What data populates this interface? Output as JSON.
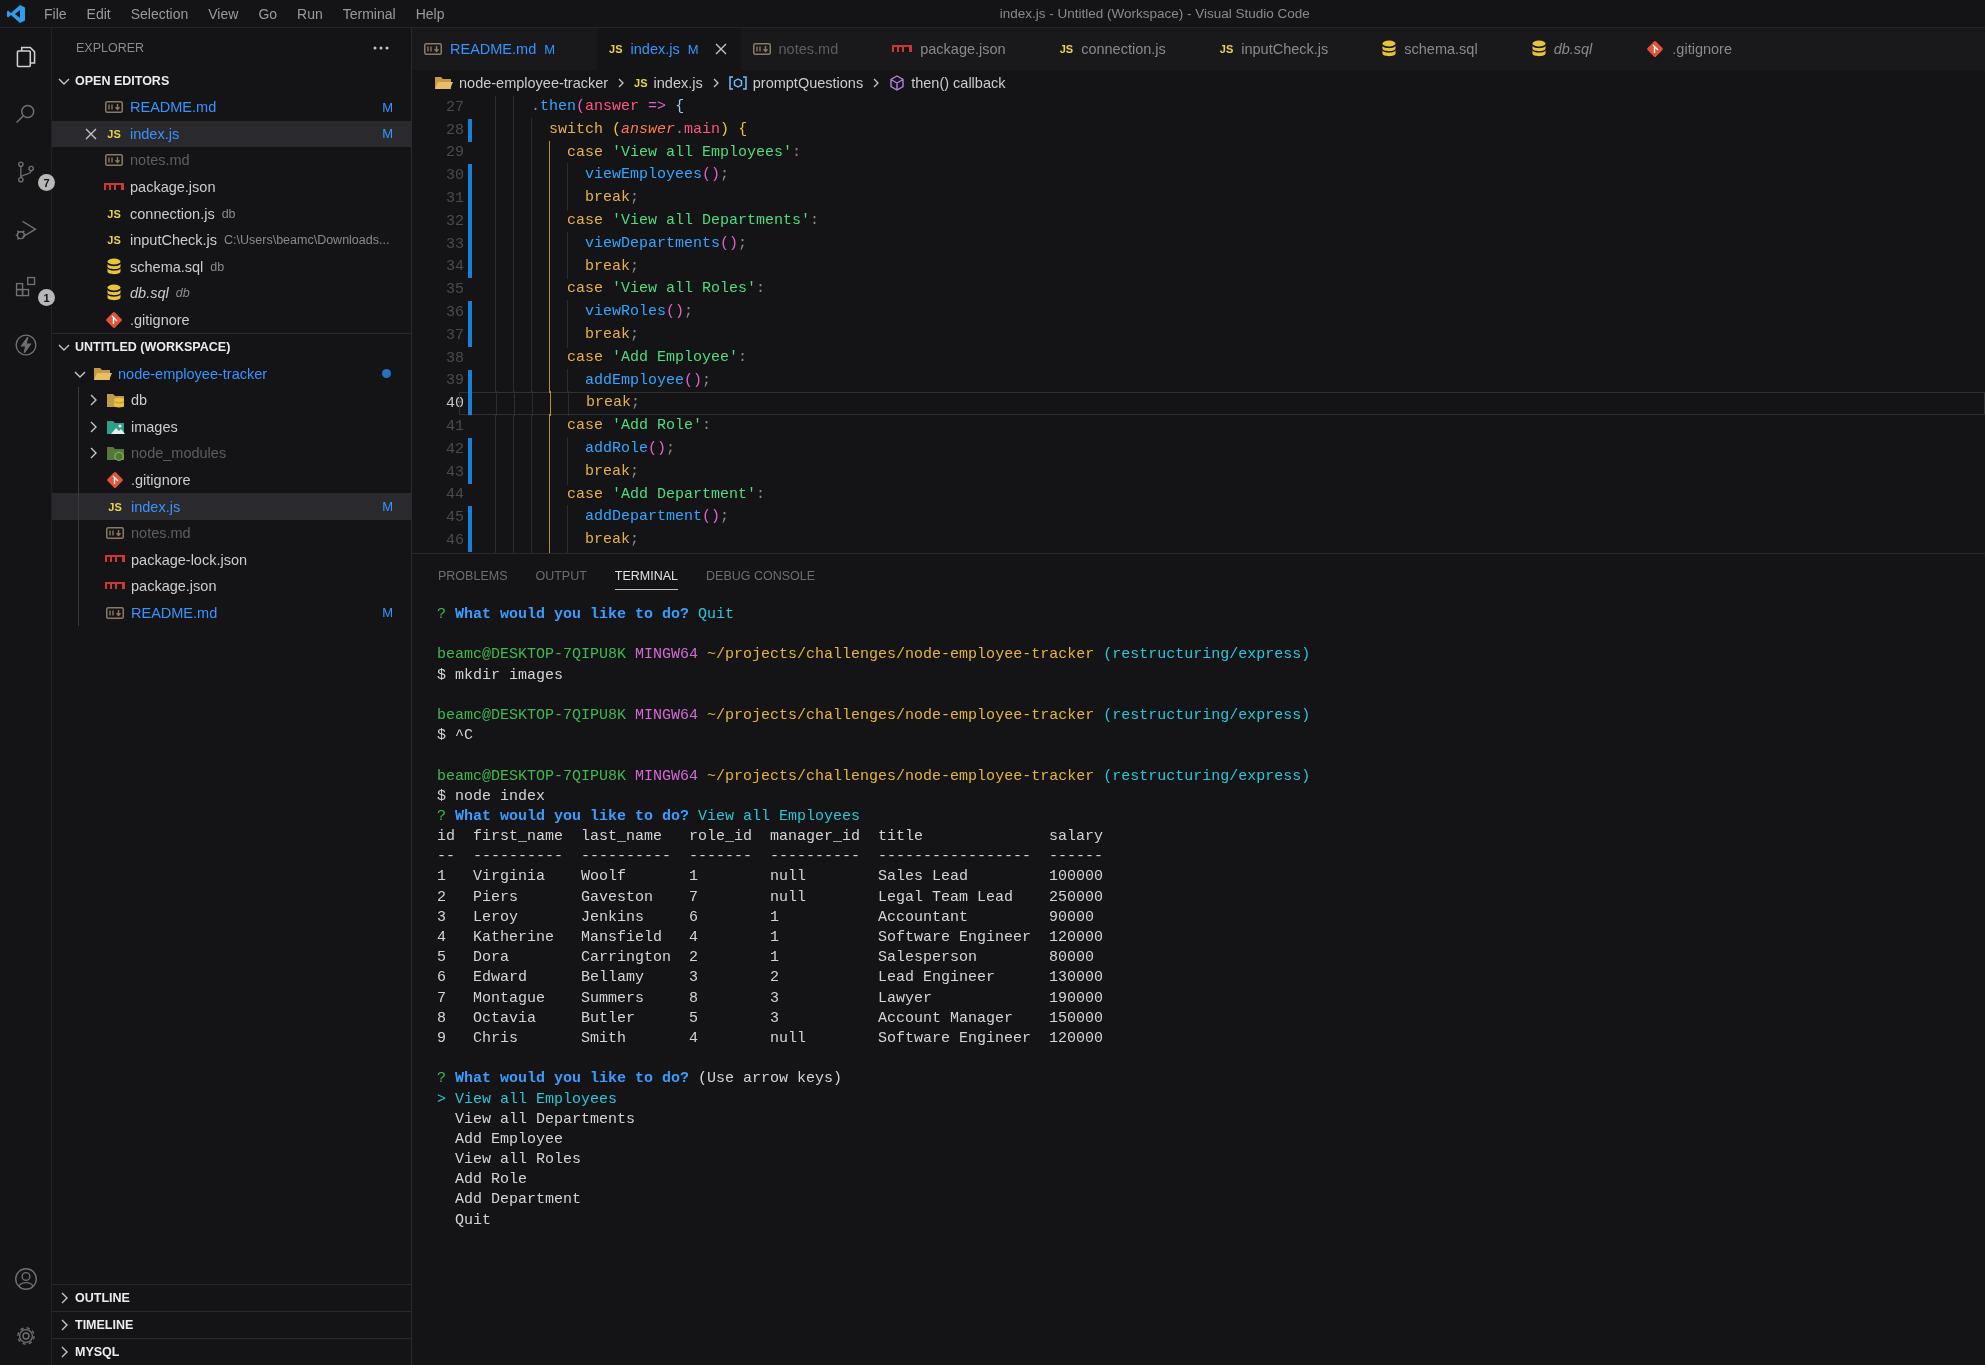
{
  "window": {
    "title": "index.js - Untitled (Workspace) - Visual Studio Code"
  },
  "menu": [
    "File",
    "Edit",
    "Selection",
    "View",
    "Go",
    "Run",
    "Terminal",
    "Help"
  ],
  "activity_bar": [
    {
      "kind": "explorer",
      "selected": true
    },
    {
      "kind": "search",
      "selected": false
    },
    {
      "kind": "source-control",
      "selected": false,
      "badge": "7"
    },
    {
      "kind": "run-debug",
      "selected": false
    },
    {
      "kind": "extensions",
      "selected": false,
      "badge": "1"
    },
    {
      "kind": "lightning",
      "selected": false
    },
    {
      "kind": "account",
      "selected": false
    },
    {
      "kind": "settings",
      "selected": false
    }
  ],
  "sidebar": {
    "title": "EXPLORER",
    "open_editors": {
      "title": "OPEN EDITORS",
      "expanded": true,
      "items": [
        {
          "kind": "markdown",
          "name": "README.md",
          "modified": true,
          "ignored": false,
          "italic": false,
          "badge": "M",
          "selected": false
        },
        {
          "kind": "js",
          "glyph": "JS",
          "name": "index.js",
          "modified": true,
          "ignored": false,
          "italic": false,
          "badge": "M",
          "selected": true
        },
        {
          "kind": "markdown",
          "name": "notes.md",
          "modified": false,
          "ignored": true,
          "italic": false,
          "selected": false
        },
        {
          "kind": "npm",
          "name": "package.json",
          "modified": false,
          "ignored": false,
          "italic": false,
          "selected": false
        },
        {
          "kind": "js",
          "glyph": "JS",
          "name": "connection.js",
          "description": "db",
          "modified": false,
          "ignored": false,
          "italic": false,
          "selected": false
        },
        {
          "kind": "js",
          "glyph": "JS",
          "name": "inputCheck.js",
          "description": "C:\\Users\\beamc\\Downloads...",
          "modified": false,
          "ignored": false,
          "italic": false,
          "selected": false
        },
        {
          "kind": "database",
          "name": "schema.sql",
          "description": "db",
          "modified": false,
          "ignored": false,
          "italic": false,
          "selected": false
        },
        {
          "kind": "database",
          "name": "db.sql",
          "description": "db",
          "modified": false,
          "ignored": false,
          "italic": true,
          "selected": false
        },
        {
          "kind": "git",
          "name": ".gitignore",
          "modified": false,
          "ignored": false,
          "italic": false,
          "selected": false
        }
      ]
    },
    "workspace": {
      "title": "UNTITLED (WORKSPACE)",
      "expanded": true,
      "tree": [
        {
          "name": "node-employee-tracker",
          "kind": "folder",
          "modified": true,
          "ignored": false,
          "dot": true,
          "expanded": true,
          "selected": false,
          "children": [
            {
              "name": "db",
              "kind": "folder-db",
              "modified": false,
              "ignored": false,
              "expanded": false,
              "selected": false
            },
            {
              "name": "images",
              "kind": "folder-images",
              "modified": false,
              "ignored": false,
              "expanded": false,
              "selected": false
            },
            {
              "name": "node_modules",
              "kind": "folder-node",
              "modified": false,
              "ignored": true,
              "expanded": false,
              "selected": false
            },
            {
              "name": ".gitignore",
              "kind": "git",
              "modified": false,
              "ignored": false,
              "selected": false
            },
            {
              "name": "index.js",
              "kind": "js",
              "glyph": "JS",
              "modified": true,
              "ignored": false,
              "badge": "M",
              "selected": true
            },
            {
              "name": "notes.md",
              "kind": "markdown",
              "modified": false,
              "ignored": true,
              "selected": false
            },
            {
              "name": "package-lock.json",
              "kind": "npm",
              "modified": false,
              "ignored": false,
              "selected": false
            },
            {
              "name": "package.json",
              "kind": "npm",
              "modified": false,
              "ignored": false,
              "selected": false
            },
            {
              "name": "README.md",
              "kind": "markdown",
              "modified": true,
              "ignored": false,
              "badge": "M",
              "selected": false
            }
          ]
        }
      ]
    },
    "sections": [
      {
        "title": "OUTLINE",
        "expanded": false
      },
      {
        "title": "TIMELINE",
        "expanded": false
      },
      {
        "title": "MYSQL",
        "expanded": false
      }
    ]
  },
  "tabs": [
    {
      "kind": "markdown",
      "label": "README.md",
      "badge": "M",
      "modified": true,
      "ignored": false,
      "italic": false,
      "selected": false
    },
    {
      "kind": "js",
      "glyph": "JS",
      "label": "index.js",
      "badge": "M",
      "modified": true,
      "ignored": false,
      "italic": false,
      "selected": true
    },
    {
      "kind": "markdown",
      "label": "notes.md",
      "modified": false,
      "ignored": true,
      "italic": false,
      "selected": false
    },
    {
      "kind": "npm",
      "label": "package.json",
      "modified": false,
      "ignored": false,
      "italic": false,
      "selected": false
    },
    {
      "kind": "js",
      "glyph": "JS",
      "label": "connection.js",
      "modified": false,
      "ignored": false,
      "italic": false,
      "selected": false
    },
    {
      "kind": "js",
      "glyph": "JS",
      "label": "inputCheck.js",
      "modified": false,
      "ignored": false,
      "italic": false,
      "selected": false
    },
    {
      "kind": "database",
      "label": "schema.sql",
      "modified": false,
      "ignored": false,
      "italic": false,
      "selected": false
    },
    {
      "kind": "database",
      "label": "db.sql",
      "modified": false,
      "ignored": false,
      "italic": true,
      "selected": false
    },
    {
      "kind": "git",
      "label": ".gitignore",
      "modified": false,
      "ignored": false,
      "italic": false,
      "selected": false
    }
  ],
  "breadcrumb": [
    {
      "kind": "folder",
      "text": "node-employee-tracker"
    },
    {
      "kind": "js",
      "glyph": "JS",
      "text": "index.js"
    },
    {
      "kind": "variable",
      "text": "promptQuestions"
    },
    {
      "kind": "method",
      "text": "then() callback"
    }
  ],
  "editor": {
    "lines": [
      {
        "number": "27",
        "changed": false,
        "current": false,
        "bracket_guide": false,
        "text": "    .then(answer => {"
      },
      {
        "number": "28",
        "changed": true,
        "current": false,
        "bracket_guide": false,
        "text": "      switch (answer.main) {"
      },
      {
        "number": "29",
        "changed": false,
        "current": false,
        "bracket_guide": true,
        "text": "        case 'View all Employees':"
      },
      {
        "number": "30",
        "changed": true,
        "current": false,
        "bracket_guide": true,
        "text": "          viewEmployees();"
      },
      {
        "number": "31",
        "changed": true,
        "current": false,
        "bracket_guide": true,
        "text": "          break;"
      },
      {
        "number": "32",
        "changed": true,
        "current": false,
        "bracket_guide": true,
        "text": "        case 'View all Departments':"
      },
      {
        "number": "33",
        "changed": true,
        "current": false,
        "bracket_guide": true,
        "text": "          viewDepartments();"
      },
      {
        "number": "34",
        "changed": true,
        "current": false,
        "bracket_guide": true,
        "text": "          break;"
      },
      {
        "number": "35",
        "changed": false,
        "current": false,
        "bracket_guide": true,
        "text": "        case 'View all Roles':"
      },
      {
        "number": "36",
        "changed": true,
        "current": false,
        "bracket_guide": true,
        "text": "          viewRoles();"
      },
      {
        "number": "37",
        "changed": true,
        "current": false,
        "bracket_guide": true,
        "text": "          break;"
      },
      {
        "number": "38",
        "changed": false,
        "current": false,
        "bracket_guide": true,
        "text": "        case 'Add Employee':"
      },
      {
        "number": "39",
        "changed": true,
        "current": false,
        "bracket_guide": true,
        "text": "          addEmployee();"
      },
      {
        "number": "40",
        "changed": true,
        "current": true,
        "bracket_guide": true,
        "text": "          break;"
      },
      {
        "number": "41",
        "changed": false,
        "current": false,
        "bracket_guide": true,
        "text": "        case 'Add Role':"
      },
      {
        "number": "42",
        "changed": true,
        "current": false,
        "bracket_guide": true,
        "text": "          addRole();"
      },
      {
        "number": "43",
        "changed": true,
        "current": false,
        "bracket_guide": true,
        "text": "          break;"
      },
      {
        "number": "44",
        "changed": false,
        "current": false,
        "bracket_guide": true,
        "text": "        case 'Add Department':"
      },
      {
        "number": "45",
        "changed": true,
        "current": false,
        "bracket_guide": true,
        "text": "          addDepartment();"
      },
      {
        "number": "46",
        "changed": true,
        "current": false,
        "bracket_guide": true,
        "text": "          break;"
      }
    ]
  },
  "panel": {
    "tabs": [
      {
        "label": "PROBLEMS",
        "selected": false
      },
      {
        "label": "OUTPUT",
        "selected": false
      },
      {
        "label": "TERMINAL",
        "selected": true
      },
      {
        "label": "DEBUG CONSOLE",
        "selected": false
      }
    ],
    "terminal": [
      {
        "kind": "prompt",
        "mark": "?",
        "question": "What would you like to do?",
        "answer": "Quit"
      },
      {
        "kind": "blank"
      },
      {
        "kind": "ps1",
        "user": "beamc@DESKTOP-7QIPU8K",
        "system": "MINGW64",
        "path": "~/projects/challenges/node-employee-tracker",
        "branch": "(restructuring/express)"
      },
      {
        "kind": "command",
        "text": "$ mkdir images"
      },
      {
        "kind": "blank"
      },
      {
        "kind": "ps1",
        "user": "beamc@DESKTOP-7QIPU8K",
        "system": "MINGW64",
        "path": "~/projects/challenges/node-employee-tracker",
        "branch": "(restructuring/express)"
      },
      {
        "kind": "command",
        "text": "$ ^C"
      },
      {
        "kind": "blank"
      },
      {
        "kind": "ps1",
        "user": "beamc@DESKTOP-7QIPU8K",
        "system": "MINGW64",
        "path": "~/projects/challenges/node-employee-tracker",
        "branch": "(restructuring/express)"
      },
      {
        "kind": "command",
        "text": "$ node index"
      },
      {
        "kind": "prompt",
        "mark": "?",
        "question": "What would you like to do?",
        "answer": "View all Employees"
      },
      {
        "kind": "table",
        "columns": [
          "id",
          "first_name",
          "last_name",
          "role_id",
          "manager_id",
          "title",
          "salary"
        ],
        "rules": [
          "--",
          "----------",
          "----------",
          "-------",
          "----------",
          "-----------------",
          "------"
        ],
        "rows": [
          [
            "1",
            "Virginia",
            "Woolf",
            "1",
            "null",
            "Sales Lead",
            "100000"
          ],
          [
            "2",
            "Piers",
            "Gaveston",
            "7",
            "null",
            "Legal Team Lead",
            "250000"
          ],
          [
            "3",
            "Leroy",
            "Jenkins",
            "6",
            "1",
            "Accountant",
            "90000"
          ],
          [
            "4",
            "Katherine",
            "Mansfield",
            "4",
            "1",
            "Software Engineer",
            "120000"
          ],
          [
            "5",
            "Dora",
            "Carrington",
            "2",
            "1",
            "Salesperson",
            "80000"
          ],
          [
            "6",
            "Edward",
            "Bellamy",
            "3",
            "2",
            "Lead Engineer",
            "130000"
          ],
          [
            "7",
            "Montague",
            "Summers",
            "8",
            "3",
            "Lawyer",
            "190000"
          ],
          [
            "8",
            "Octavia",
            "Butler",
            "5",
            "3",
            "Account Manager",
            "150000"
          ],
          [
            "9",
            "Chris",
            "Smith",
            "4",
            "null",
            "Software Engineer",
            "120000"
          ]
        ]
      },
      {
        "kind": "blank"
      },
      {
        "kind": "menu",
        "mark": "?",
        "question": "What would you like to do?",
        "hint": "(Use arrow keys)",
        "pointer": ">",
        "choices": [
          {
            "label": "View all Employees",
            "selected": true
          },
          {
            "label": "View all Departments",
            "selected": false
          },
          {
            "label": "Add Employee",
            "selected": false
          },
          {
            "label": "View all Roles",
            "selected": false
          },
          {
            "label": "Add Role",
            "selected": false
          },
          {
            "label": "Add Department",
            "selected": false
          },
          {
            "label": "Quit",
            "selected": false
          }
        ]
      }
    ]
  }
}
